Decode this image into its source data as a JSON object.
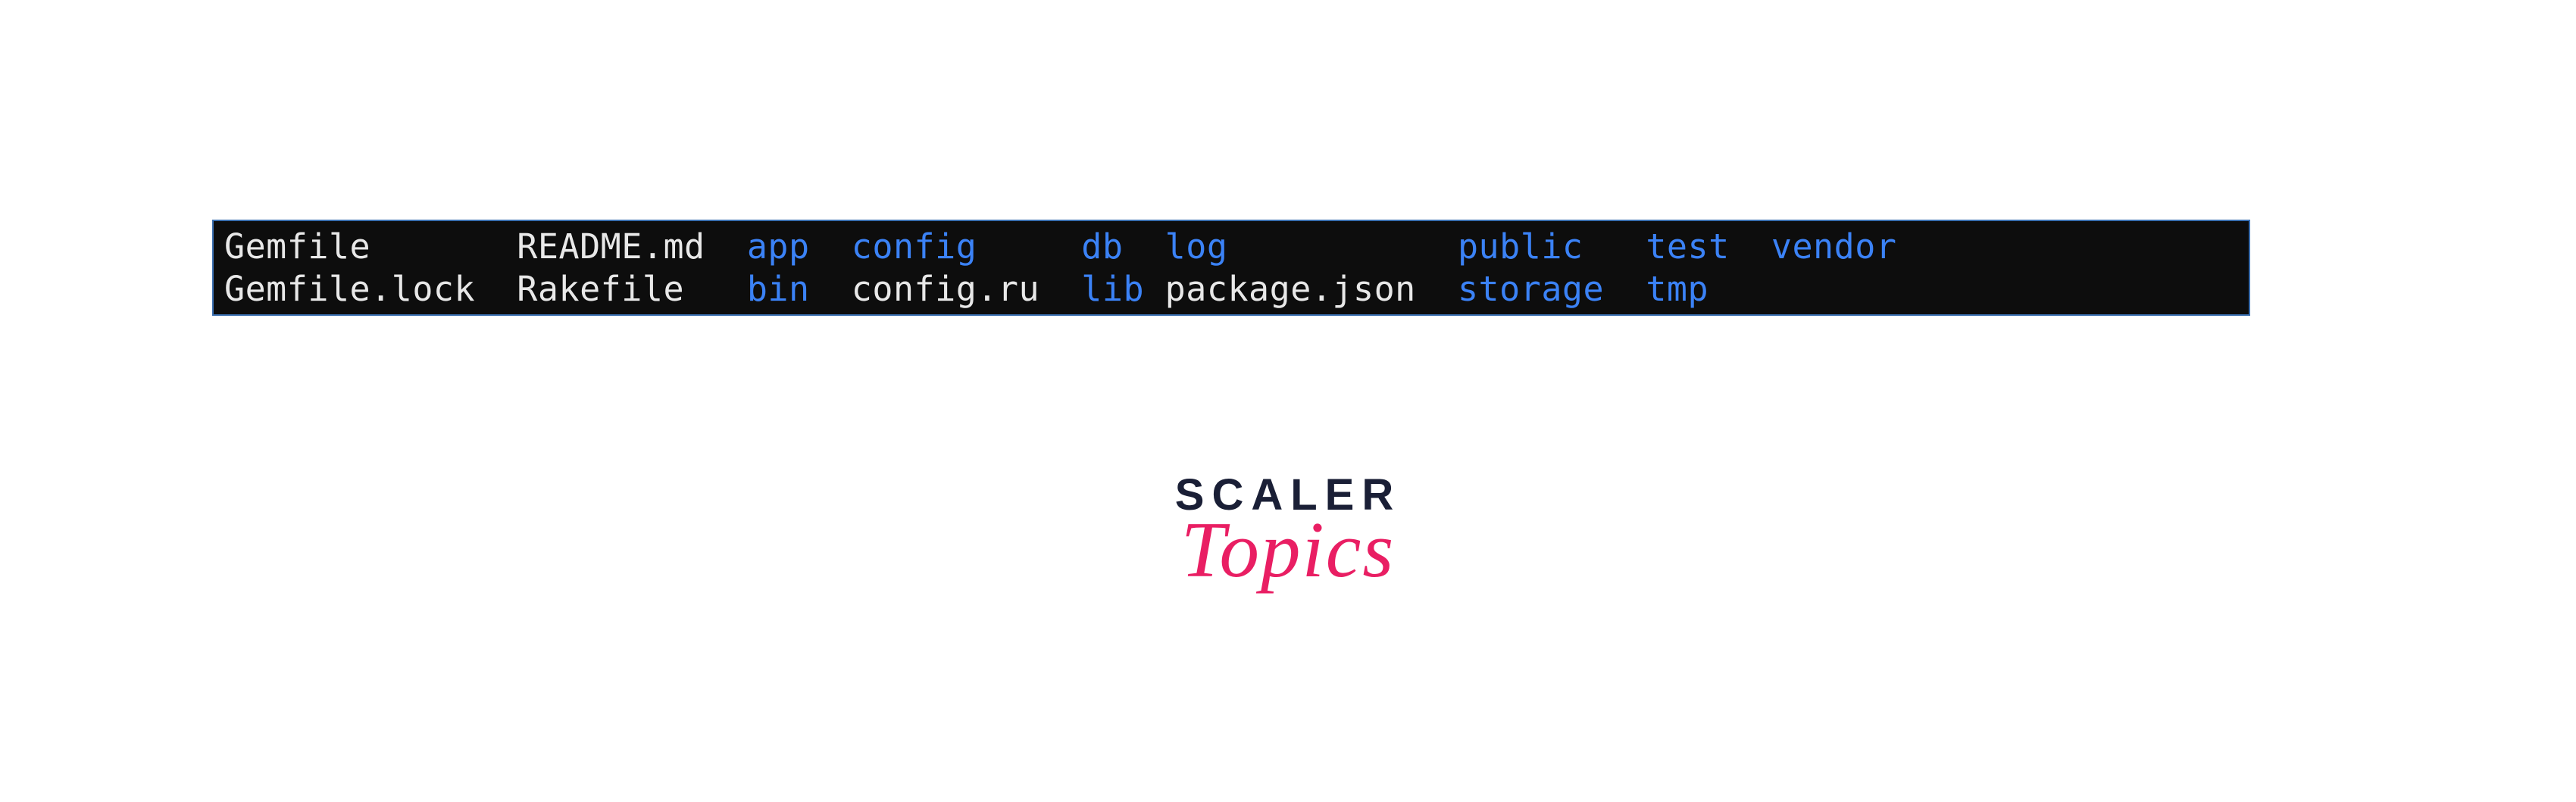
{
  "terminal": {
    "rows": [
      [
        {
          "text": "Gemfile",
          "type": "file",
          "width": 14
        },
        {
          "text": "README.md",
          "type": "file",
          "width": 11
        },
        {
          "text": "app",
          "type": "dir",
          "width": 5
        },
        {
          "text": "config",
          "type": "dir",
          "width": 11
        },
        {
          "text": "db",
          "type": "dir",
          "width": 4
        },
        {
          "text": "log",
          "type": "dir",
          "width": 14
        },
        {
          "text": "public",
          "type": "dir",
          "width": 9
        },
        {
          "text": "test",
          "type": "dir",
          "width": 6
        },
        {
          "text": "vendor",
          "type": "dir",
          "width": 6
        }
      ],
      [
        {
          "text": "Gemfile.lock",
          "type": "file",
          "width": 14
        },
        {
          "text": "Rakefile",
          "type": "file",
          "width": 11
        },
        {
          "text": "bin",
          "type": "dir",
          "width": 5
        },
        {
          "text": "config.ru",
          "type": "file",
          "width": 11
        },
        {
          "text": "lib",
          "type": "dir",
          "width": 4
        },
        {
          "text": "package.json",
          "type": "file",
          "width": 14
        },
        {
          "text": "storage",
          "type": "dir",
          "width": 9
        },
        {
          "text": "tmp",
          "type": "dir",
          "width": 6
        }
      ]
    ]
  },
  "logo": {
    "line1": "SCALER",
    "line2": "Topics"
  }
}
